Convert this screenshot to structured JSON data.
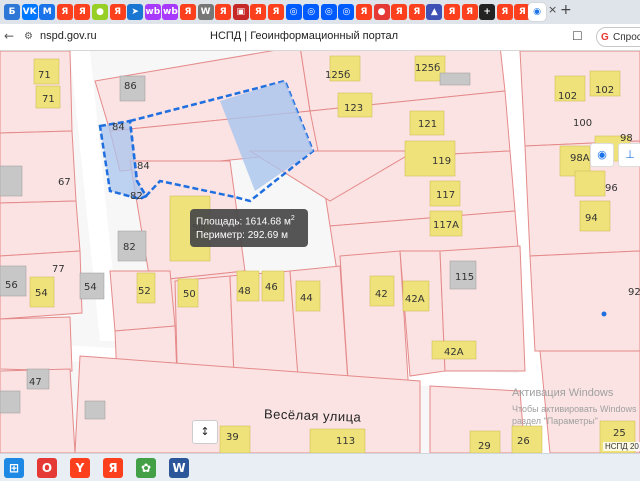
{
  "browser": {
    "tabs": [
      {
        "icon": "mail-icon",
        "label": "Б",
        "color": "#2d78d6"
      },
      {
        "icon": "vk-icon",
        "label": "VK",
        "color": "#0077ff"
      },
      {
        "icon": "mail-icon",
        "label": "M",
        "color": "#1a73e8"
      },
      {
        "icon": "yandex-icon",
        "label": "Я",
        "color": "#fc3f1d"
      },
      {
        "icon": "yandex-icon",
        "label": "Я",
        "color": "#fc3f1d"
      },
      {
        "icon": "avito-icon",
        "label": "●",
        "color": "#97cf26"
      },
      {
        "icon": "yandex-icon",
        "label": "Я",
        "color": "#fc3f1d"
      },
      {
        "icon": "send-icon",
        "label": "➤",
        "color": "#1976d2"
      },
      {
        "icon": "wb-icon",
        "label": "wb",
        "color": "#a73afd"
      },
      {
        "icon": "wb-icon",
        "label": "wb",
        "color": "#a73afd"
      },
      {
        "icon": "yandex-icon",
        "label": "Я",
        "color": "#fc3f1d"
      },
      {
        "icon": "wikipedia-icon",
        "label": "W",
        "color": "#777777"
      },
      {
        "icon": "yandex-icon",
        "label": "Я",
        "color": "#fc3f1d"
      },
      {
        "icon": "bookmark-icon",
        "label": "▣",
        "color": "#c62828"
      },
      {
        "icon": "yandex-icon",
        "label": "Я",
        "color": "#fc3f1d"
      },
      {
        "icon": "yandex-icon",
        "label": "Я",
        "color": "#fc3f1d"
      },
      {
        "icon": "ozon-icon",
        "label": "◎",
        "color": "#005bff"
      },
      {
        "icon": "ozon-icon",
        "label": "◎",
        "color": "#005bff"
      },
      {
        "icon": "ozon-icon",
        "label": "◎",
        "color": "#005bff"
      },
      {
        "icon": "ozon-icon",
        "label": "◎",
        "color": "#005bff"
      },
      {
        "icon": "yandex-icon",
        "label": "Я",
        "color": "#fc3f1d"
      },
      {
        "icon": "pin-icon",
        "label": "●",
        "color": "#e53935"
      },
      {
        "icon": "yandex-icon",
        "label": "Я",
        "color": "#fc3f1d"
      },
      {
        "icon": "yandex-icon",
        "label": "Я",
        "color": "#fc3f1d"
      },
      {
        "icon": "person-icon",
        "label": "▲",
        "color": "#3f51b5"
      },
      {
        "icon": "yandex-icon",
        "label": "Я",
        "color": "#fc3f1d"
      },
      {
        "icon": "yandex-icon",
        "label": "Я",
        "color": "#fc3f1d"
      },
      {
        "icon": "plus-icon",
        "label": "+",
        "color": "#222222"
      },
      {
        "icon": "yandex-icon",
        "label": "Я",
        "color": "#fc3f1d"
      },
      {
        "icon": "yandex-icon",
        "label": "Я",
        "color": "#fc3f1d"
      }
    ],
    "active_tab_label": "◉",
    "close_tab": "×",
    "new_tab": "+",
    "url": "nspd.gov.ru",
    "page_title": "НСПД | Геоинформационный портал",
    "ask_button": "Спрос",
    "ask_icon_label": "G"
  },
  "map": {
    "tooltip": {
      "area_label": "Площадь:",
      "area_value": "1614.68 м",
      "area_unit_sup": "2",
      "perimeter_label": "Периметр:",
      "perimeter_value": "292.69 м"
    },
    "street_name": "Весёлая  улица",
    "numbers": [
      "71",
      "71",
      "86",
      "125б",
      "125б",
      "123",
      "102",
      "102",
      "121",
      "100",
      "98",
      "84",
      "84",
      "119",
      "98А",
      "67",
      "82",
      "117",
      "96",
      "94",
      "50",
      "117А",
      "77",
      "82",
      "115",
      "92",
      "56",
      "54",
      "54",
      "52",
      "50",
      "48",
      "46",
      "44",
      "42",
      "42А",
      "42А",
      "47",
      "39",
      "113",
      "29",
      "26",
      "25"
    ],
    "select_arrow": "↕",
    "tool_locate": "◉",
    "tool_ruler": "⊥",
    "watermark_title": "Активация Windows",
    "watermark_line2": "Чтобы активировать Windows",
    "watermark_line3": "раздел \"Параметры\"",
    "copyright": "НСПД 20"
  },
  "taskbar": {
    "items": [
      {
        "icon": "start-icon",
        "label": "⊞",
        "color": "#1e88e5"
      },
      {
        "icon": "opera-icon",
        "label": "O",
        "color": "#e53935"
      },
      {
        "icon": "yandex-browser-icon",
        "label": "Y",
        "color": "#fc3f1d"
      },
      {
        "icon": "yandex-icon",
        "label": "Я",
        "color": "#fc3f1d"
      },
      {
        "icon": "photos-icon",
        "label": "✿",
        "color": "#43a047"
      },
      {
        "icon": "word-icon",
        "label": "W",
        "color": "#2b579a"
      }
    ]
  },
  "colors": {
    "parcel_fill": "#fbe3e3",
    "parcel_stroke": "#e58a8a",
    "building_fill": "#efe27a",
    "gray_building": "#c7c7c7",
    "selection_fill": "#a9c4ee",
    "selection_stroke": "#1f6fe0"
  }
}
